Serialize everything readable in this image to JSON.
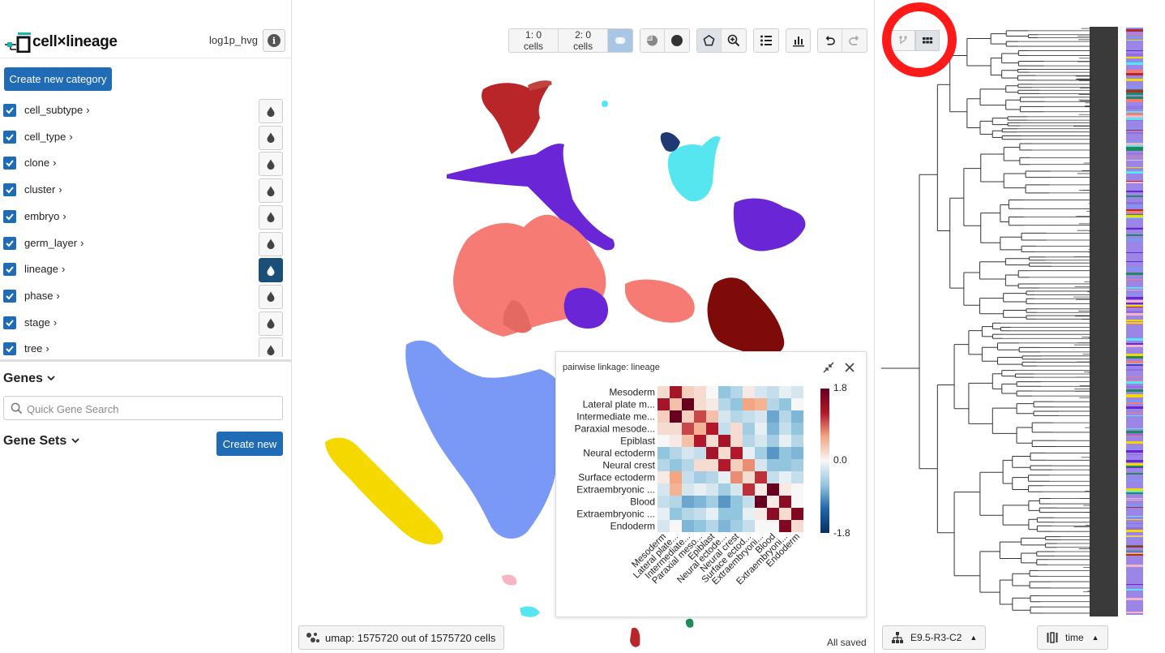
{
  "app": {
    "logo_text": "cell×lineage",
    "dataset": "log1p_hvg"
  },
  "categories": {
    "create_label": "Create new category",
    "items": [
      {
        "label": "cell_subtype",
        "active": false
      },
      {
        "label": "cell_type",
        "active": false
      },
      {
        "label": "clone",
        "active": false
      },
      {
        "label": "cluster",
        "active": false
      },
      {
        "label": "embryo",
        "active": false
      },
      {
        "label": "germ_layer",
        "active": false
      },
      {
        "label": "lineage",
        "active": true
      },
      {
        "label": "phase",
        "active": false
      },
      {
        "label": "stage",
        "active": false
      },
      {
        "label": "tree",
        "active": false
      }
    ]
  },
  "genes": {
    "title": "Genes",
    "search_placeholder": "Quick Gene Search",
    "sets_title": "Gene Sets",
    "create_label": "Create new"
  },
  "toolbar": {
    "set1": "1: 0 cells",
    "set2": "2: 0 cells"
  },
  "heatmap": {
    "title": "pairwise linkage: lineage",
    "labels_full": [
      "Mesoderm",
      "Lateral plate m...",
      "Intermediate me...",
      "Paraxial mesode...",
      "Epiblast",
      "Neural ectoderm",
      "Neural crest",
      "Surface ectoderm",
      "Extraembryonic ...",
      "Blood",
      "Extraembryonic ...",
      "Endoderm"
    ],
    "labels_x": [
      "Mesoderm",
      "Lateral plate...",
      "Intermediate...",
      "Paraxial meso...",
      "Epiblast",
      "Neural ectode...",
      "Neural crest",
      "Surface ectod...",
      "Extraembryoni...",
      "Blood",
      "Extraembryoni...",
      "Endoderm"
    ],
    "colorbar_max": "1.8",
    "colorbar_mid": "0.0",
    "colorbar_min": "-1.8",
    "matrix": [
      [
        0.2,
        1.3,
        0.3,
        0.2,
        0.0,
        -0.6,
        -0.4,
        0.1,
        -0.2,
        -0.3,
        -0.1,
        -0.2
      ],
      [
        1.3,
        0.4,
        1.8,
        0.2,
        0.1,
        -0.4,
        -0.6,
        0.6,
        0.5,
        -0.4,
        -0.6,
        0.0
      ],
      [
        0.3,
        1.8,
        0.3,
        1.0,
        0.4,
        -0.2,
        -0.4,
        -0.3,
        -0.2,
        -0.8,
        -0.4,
        -0.7
      ],
      [
        0.2,
        0.2,
        1.0,
        0.5,
        1.2,
        -0.3,
        0.2,
        -0.5,
        -0.1,
        -0.7,
        -0.3,
        -0.6
      ],
      [
        0.0,
        0.1,
        0.4,
        1.2,
        0.2,
        1.3,
        0.2,
        -0.4,
        -0.2,
        -0.5,
        -0.1,
        -0.4
      ],
      [
        -0.6,
        -0.4,
        -0.2,
        -0.3,
        1.3,
        0.2,
        1.2,
        -0.1,
        -0.5,
        -0.9,
        -0.6,
        -0.7
      ],
      [
        -0.4,
        -0.6,
        -0.4,
        0.2,
        0.2,
        1.2,
        0.3,
        0.7,
        -0.2,
        -0.6,
        -0.6,
        -0.5
      ],
      [
        0.1,
        0.6,
        -0.3,
        -0.5,
        -0.4,
        -0.1,
        0.7,
        0.2,
        1.1,
        -0.3,
        -0.1,
        -0.3
      ],
      [
        -0.2,
        0.5,
        -0.2,
        -0.1,
        -0.2,
        -0.5,
        -0.2,
        1.1,
        0.1,
        1.8,
        0.1,
        0.0
      ],
      [
        -0.3,
        -0.4,
        -0.8,
        -0.7,
        -0.5,
        -0.9,
        -0.6,
        -0.3,
        1.8,
        0.1,
        1.5,
        0.0
      ],
      [
        -0.1,
        -0.6,
        -0.4,
        -0.3,
        -0.1,
        -0.6,
        -0.6,
        -0.1,
        0.1,
        1.5,
        0.2,
        1.6
      ],
      [
        -0.2,
        0.0,
        -0.7,
        -0.6,
        -0.4,
        -0.7,
        -0.5,
        -0.3,
        0.0,
        0.0,
        1.6,
        0.2
      ]
    ]
  },
  "footer": {
    "embedding": "umap: 1575720 out of 1575720 cells",
    "saved": "All saved"
  },
  "tree": {
    "node_label": "E9.5-R3-C2",
    "color_label": "time"
  },
  "colors": {
    "primary": "#1f6bb5",
    "active_color_btn": "#1c4f78",
    "red_ring": "#ff1a1a",
    "tree_dense": "#3a3a3a"
  }
}
